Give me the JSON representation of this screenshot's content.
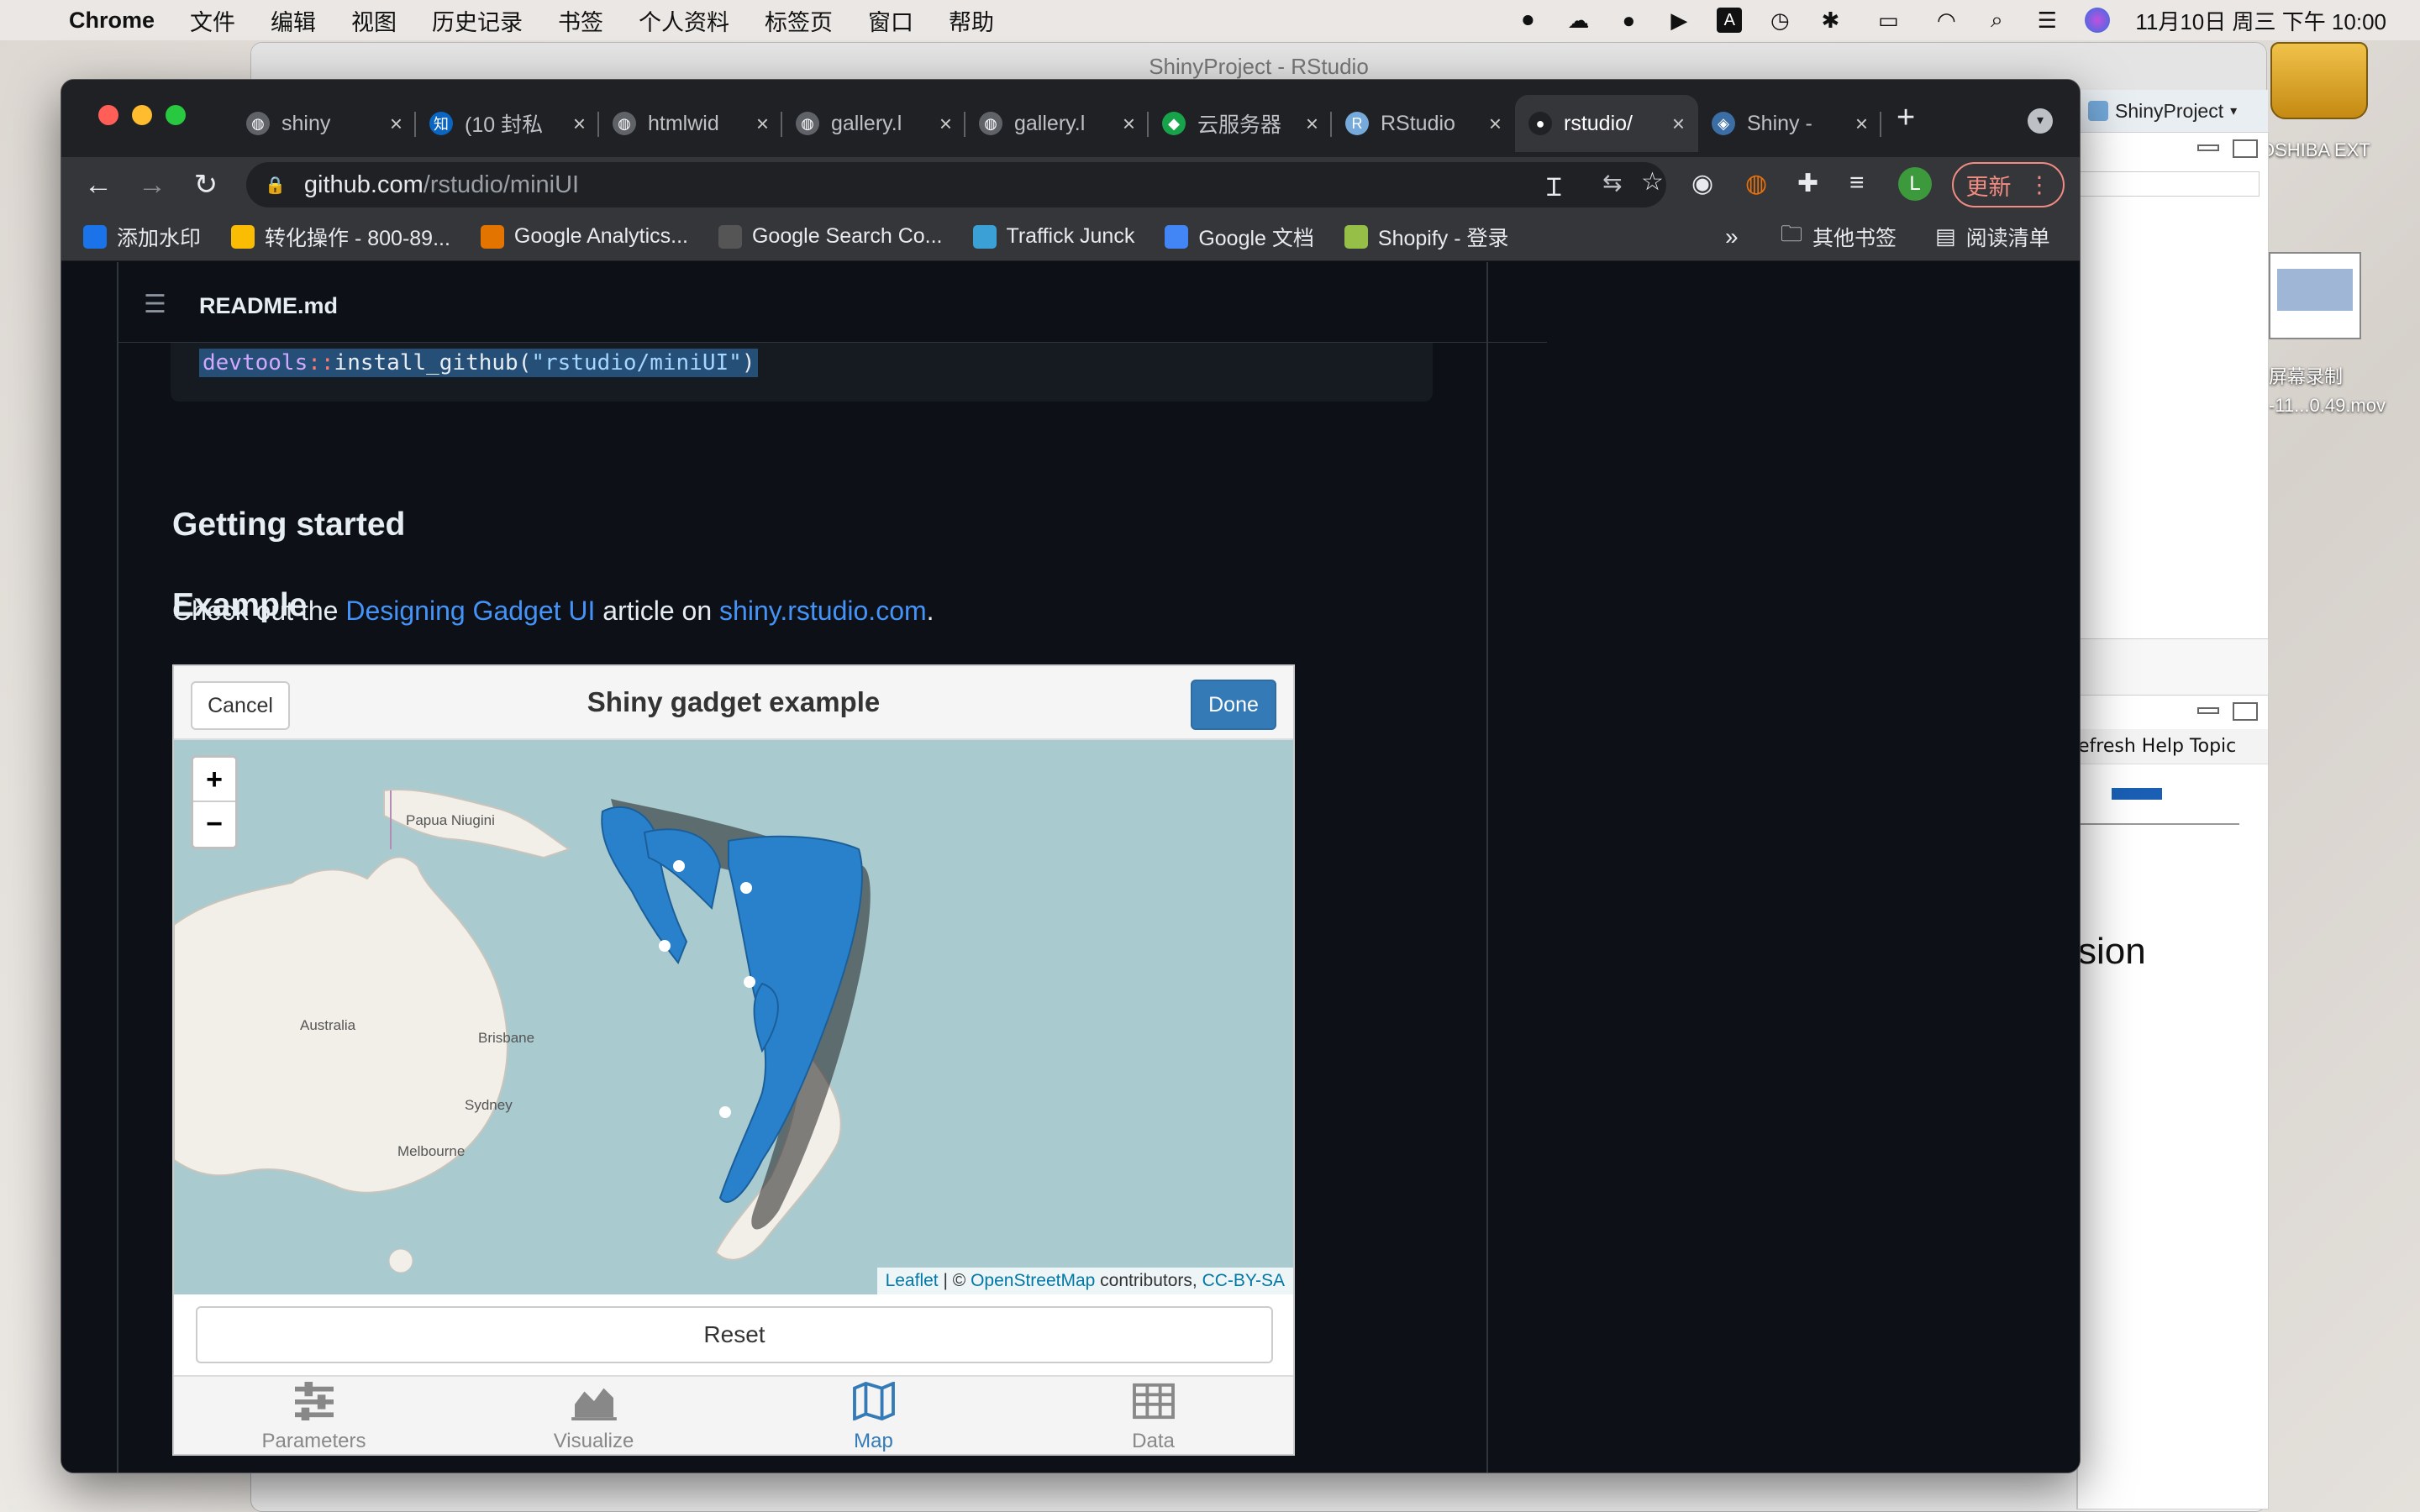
{
  "menubar": {
    "app_name": "Chrome",
    "items": [
      "文件",
      "编辑",
      "视图",
      "历史记录",
      "书签",
      "个人资料",
      "标签页",
      "窗口",
      "帮助"
    ],
    "clock": "11月10日 周三 下午 10:00"
  },
  "desktop": {
    "drive_label": "OSHIBA EXT",
    "recording_label_line1": "屏幕录制",
    "recording_label_line2": "-11...0.49.mov"
  },
  "rstudio": {
    "title": "ShinyProject - RStudio",
    "project": "ShinyProject",
    "help_refresh": "efresh Help Topic",
    "sion_text": "sion"
  },
  "chrome": {
    "tabs": [
      {
        "label": "shiny",
        "icon": "globe-icon"
      },
      {
        "label": "(10 封私",
        "icon": "zhihu-icon"
      },
      {
        "label": "htmlwid",
        "icon": "globe-icon"
      },
      {
        "label": "gallery.l",
        "icon": "globe-icon"
      },
      {
        "label": "gallery.l",
        "icon": "globe-icon"
      },
      {
        "label": "云服务器",
        "icon": "cloud-icon"
      },
      {
        "label": "RStudio",
        "icon": "rstudio-icon"
      },
      {
        "label": "rstudio/",
        "icon": "github-icon",
        "active": true
      },
      {
        "label": "Shiny -",
        "icon": "shiny-icon"
      }
    ],
    "url_host": "github.com",
    "url_path": "/rstudio/miniUI",
    "update_label": "更新",
    "profile_initial": "L",
    "bookmarks": [
      {
        "label": "添加水印",
        "color": "#1a73e8"
      },
      {
        "label": "转化操作 - 800-89...",
        "color": "#fbbc04"
      },
      {
        "label": "Google Analytics...",
        "color": "#e37400"
      },
      {
        "label": "Google Search Co...",
        "color": "#555555"
      },
      {
        "label": "Traffick Junck",
        "color": "#3ba0d6"
      },
      {
        "label": "Google 文档",
        "color": "#4285f4"
      },
      {
        "label": "Shopify - 登录",
        "color": "#95bf47"
      }
    ],
    "bookmarks_more": "»",
    "other_bookmarks": "其他书签",
    "reading_list": "阅读清单"
  },
  "readme": {
    "file": "README.md",
    "code": {
      "ns": "devtools",
      "op": "::",
      "fn": "install_github(",
      "str": "\"rstudio/miniUI\"",
      "end": ")"
    },
    "h_getting_started": "Getting started",
    "intro_pre": "Check out the ",
    "intro_link1": "Designing Gadget UI",
    "intro_mid": " article on ",
    "intro_link2": "shiny.rstudio.com",
    "intro_post": ".",
    "h_example": "Example"
  },
  "gadget": {
    "cancel": "Cancel",
    "title": "Shiny gadget example",
    "done": "Done",
    "zoom_in": "+",
    "zoom_out": "−",
    "map_labels": {
      "papua": "Papua Niugini",
      "australia": "Australia",
      "brisbane": "Brisbane",
      "sydney": "Sydney",
      "melbourne": "Melbourne"
    },
    "attribution": {
      "leaflet": "Leaflet",
      "sep": " | © ",
      "osm": "OpenStreetMap",
      "contrib": " contributors, ",
      "license": "CC-BY-SA"
    },
    "reset": "Reset",
    "tabs": [
      {
        "label": "Parameters",
        "icon": "sliders-icon"
      },
      {
        "label": "Visualize",
        "icon": "area-chart-icon"
      },
      {
        "label": "Map",
        "icon": "map-icon",
        "active": true
      },
      {
        "label": "Data",
        "icon": "table-icon"
      }
    ],
    "accent": "#337ab7"
  }
}
